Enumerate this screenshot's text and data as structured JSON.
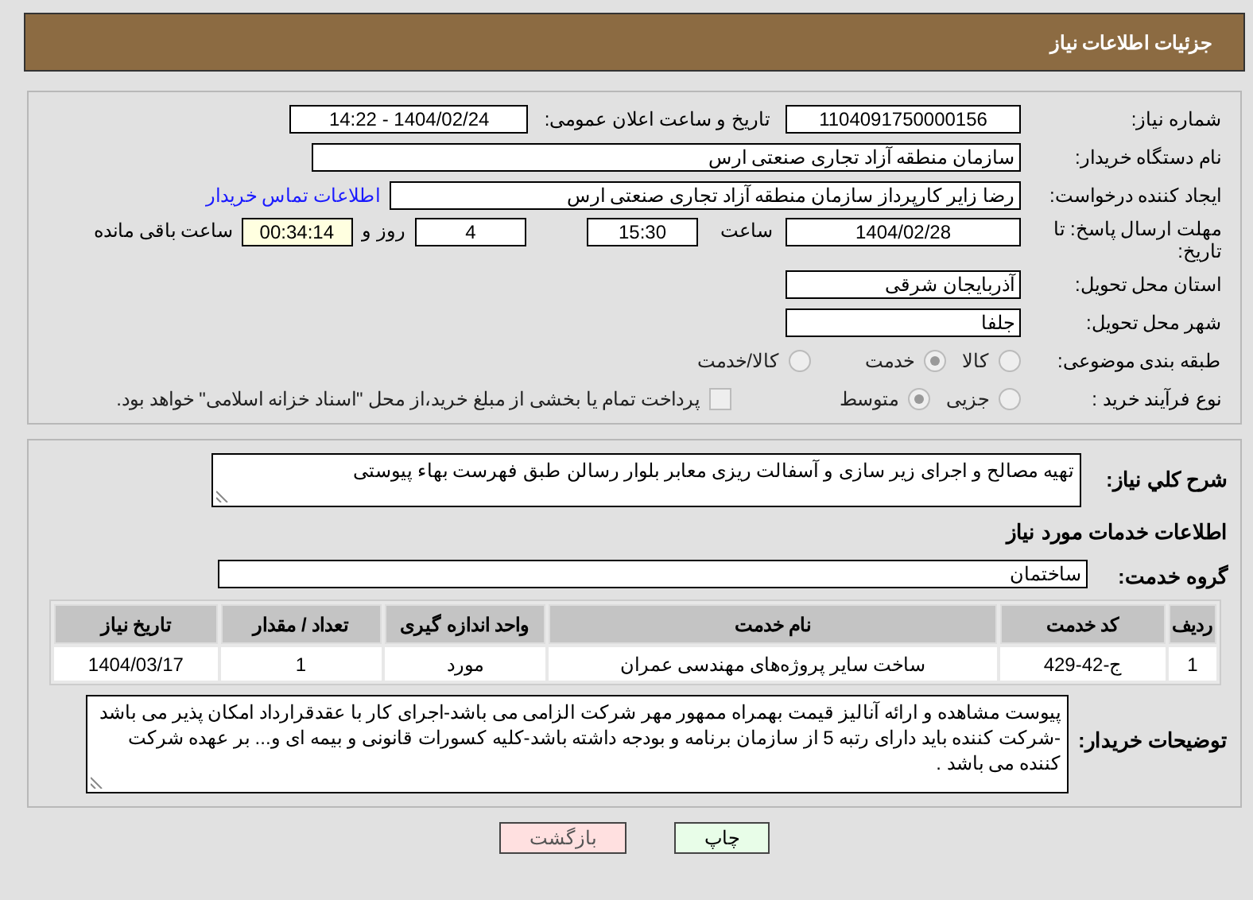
{
  "header": {
    "title": "جزئیات اطلاعات نیاز"
  },
  "need_number": {
    "label": "شماره نیاز:",
    "value": "1104091750000156"
  },
  "announce": {
    "label": "تاریخ و ساعت اعلان عمومی:",
    "value": "1404/02/24 - 14:22"
  },
  "buyer_org": {
    "label": "نام دستگاه خریدار:",
    "value": "سازمان منطقه آزاد تجاری صنعتی ارس"
  },
  "creator": {
    "label": "ایجاد کننده درخواست:",
    "value": "رضا زایر کارپرداز سازمان منطقه آزاد تجاری صنعتی ارس",
    "link": "اطلاعات تماس خریدار"
  },
  "deadline": {
    "label": "مهلت ارسال پاسخ: تا تاریخ:",
    "date": "1404/02/28",
    "time_label": "ساعت",
    "time": "15:30",
    "days": "4",
    "days_label": "روز و",
    "remaining": "00:34:14",
    "remaining_label": "ساعت باقی مانده"
  },
  "province": {
    "label": "استان محل تحویل:",
    "value": "آذربایجان شرقی"
  },
  "city": {
    "label": "شهر محل تحویل:",
    "value": "جلفا"
  },
  "category": {
    "label": "طبقه بندی موضوعی:",
    "options": [
      {
        "label": "کالا",
        "selected": false
      },
      {
        "label": "خدمت",
        "selected": true
      },
      {
        "label": "کالا/خدمت",
        "selected": false
      }
    ]
  },
  "purchase_type": {
    "label": "نوع فرآیند خرید :",
    "options": [
      {
        "label": "جزیی",
        "selected": false
      },
      {
        "label": "متوسط",
        "selected": true
      }
    ],
    "payment": {
      "label": "پرداخت تمام یا بخشی از مبلغ خرید،از محل \"اسناد خزانه اسلامی\" خواهد بود.",
      "checked": false
    }
  },
  "description": {
    "label": "شرح کلي نياز:",
    "value": "تهیه مصالح و اجرای زیر سازی و آسفالت ریزی معابر بلوار رسالن طبق فهرست بهاء پیوستی"
  },
  "services_title": "اطلاعات خدمات مورد نیاز",
  "service_group": {
    "label": "گروه خدمت:",
    "value": "ساختمان"
  },
  "table": {
    "columns": [
      "ردیف",
      "کد خدمت",
      "نام خدمت",
      "واحد اندازه گیری",
      "تعداد / مقدار",
      "تاریخ نیاز"
    ],
    "rows": [
      [
        "1",
        "ج-42-429",
        "ساخت سایر پروژه‌های مهندسی عمران",
        "مورد",
        "1",
        "1404/03/17"
      ]
    ]
  },
  "buyer_notes": {
    "label": "توضیحات خریدار:",
    "value": "پیوست مشاهده و ارائه آنالیز قیمت بهمراه ممهور مهر شرکت الزامی می باشد-اجرای کار با عقدقرارداد امکان پذیر می باشد -شرکت کننده باید دارای رتبه 5 از سازمان برنامه و بودجه داشته باشد-کلیه کسورات قانونی و بیمه ای و... بر عهده شرکت کننده می باشد ."
  },
  "buttons": [
    {
      "label": "چاپ",
      "kind": "print"
    },
    {
      "label": "بازگشت",
      "kind": "back"
    }
  ]
}
